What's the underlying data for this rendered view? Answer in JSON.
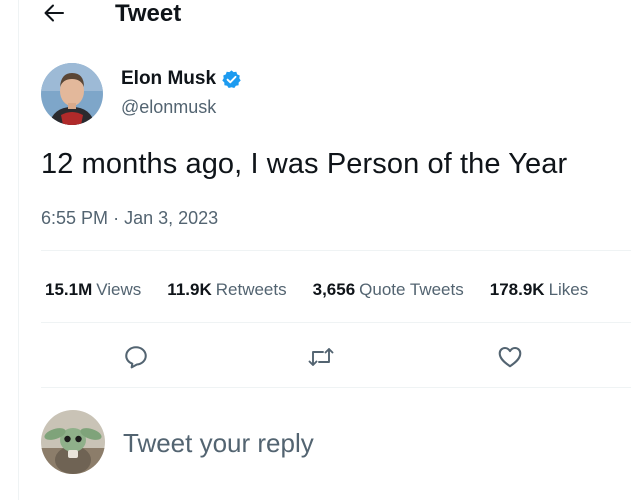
{
  "header": {
    "title": "Tweet",
    "back_icon": "arrow-left-icon"
  },
  "author": {
    "name": "Elon Musk",
    "handle": "@elonmusk",
    "verified": true,
    "verified_color": "#1d9bf0"
  },
  "tweet": {
    "text": "12 months ago, I was Person of the Year",
    "time": "6:55 PM",
    "separator": "·",
    "date": "Jan 3, 2023"
  },
  "stats": [
    {
      "value": "15.1M",
      "label": "Views"
    },
    {
      "value": "11.9K",
      "label": "Retweets"
    },
    {
      "value": "3,656",
      "label": "Quote Tweets"
    },
    {
      "value": "178.9K",
      "label": "Likes"
    }
  ],
  "actions": [
    {
      "name": "reply",
      "icon": "reply-bubble-icon"
    },
    {
      "name": "retweet",
      "icon": "retweet-icon"
    },
    {
      "name": "like",
      "icon": "heart-icon"
    }
  ],
  "reply": {
    "placeholder": "Tweet your reply"
  },
  "colors": {
    "text": "#0f1419",
    "secondary": "#536471",
    "border": "#eff3f4"
  }
}
